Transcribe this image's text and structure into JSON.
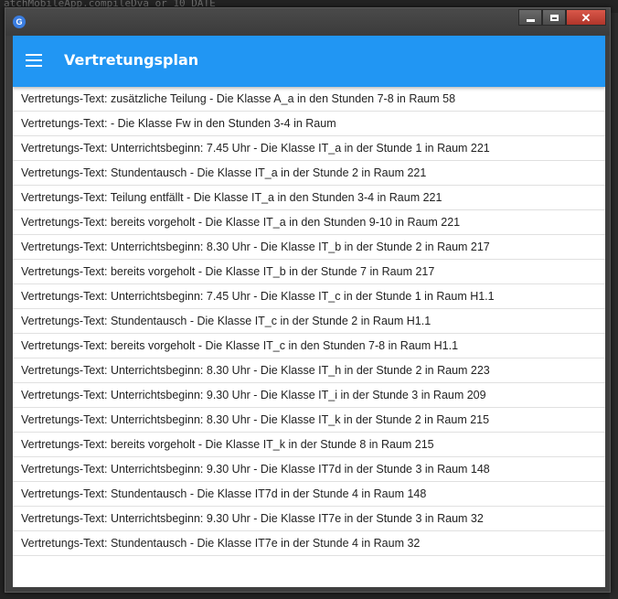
{
  "app": {
    "title": "Vertretungsplan",
    "icon_glyph": "G",
    "accent_color": "#2196f3"
  },
  "background": {
    "top_text": "atchMobileApp.compileDva or 10 DATE"
  },
  "window_controls": {
    "minimize_icon": "minimize-icon",
    "maximize_icon": "maximize-icon",
    "close_glyph": "✕"
  },
  "entries": [
    "Vertretungs-Text: zusätzliche Teilung - Die Klasse A_a in den Stunden 7-8 in Raum 58",
    "Vertretungs-Text:  - Die Klasse Fw in den Stunden 3-4 in Raum",
    "Vertretungs-Text: Unterrichtsbeginn: 7.45 Uhr - Die Klasse IT_a in der Stunde 1 in Raum 221",
    "Vertretungs-Text: Stundentausch - Die Klasse IT_a in der Stunde 2 in Raum 221",
    "Vertretungs-Text: Teilung entfällt - Die Klasse IT_a in den Stunden 3-4 in Raum 221",
    "Vertretungs-Text: bereits vorgeholt - Die Klasse IT_a in den Stunden 9-10 in Raum 221",
    "Vertretungs-Text: Unterrichtsbeginn: 8.30 Uhr - Die Klasse IT_b in der Stunde 2 in Raum 217",
    "Vertretungs-Text: bereits vorgeholt - Die Klasse IT_b in der Stunde 7 in Raum 217",
    "Vertretungs-Text: Unterrichtsbeginn: 7.45 Uhr - Die Klasse IT_c in der Stunde 1 in Raum H1.1",
    "Vertretungs-Text: Stundentausch - Die Klasse IT_c in der Stunde 2 in Raum H1.1",
    "Vertretungs-Text: bereits vorgeholt - Die Klasse IT_c in den Stunden 7-8 in Raum H1.1",
    "Vertretungs-Text: Unterrichtsbeginn: 8.30 Uhr - Die Klasse IT_h in der Stunde 2 in Raum 223",
    "Vertretungs-Text: Unterrichtsbeginn: 9.30 Uhr - Die Klasse IT_i in der Stunde 3 in Raum 209",
    "Vertretungs-Text: Unterrichtsbeginn: 8.30 Uhr - Die Klasse IT_k in der Stunde 2 in Raum 215",
    "Vertretungs-Text: bereits vorgeholt - Die Klasse IT_k in der Stunde 8 in Raum 215",
    "Vertretungs-Text: Unterrichtsbeginn: 9.30 Uhr - Die Klasse IT7d in der Stunde 3 in Raum 148",
    "Vertretungs-Text: Stundentausch - Die Klasse IT7d in der Stunde 4 in Raum 148",
    "Vertretungs-Text: Unterrichtsbeginn: 9.30 Uhr - Die Klasse IT7e in der Stunde 3 in Raum 32",
    "Vertretungs-Text: Stundentausch - Die Klasse IT7e in der Stunde 4 in Raum 32"
  ]
}
